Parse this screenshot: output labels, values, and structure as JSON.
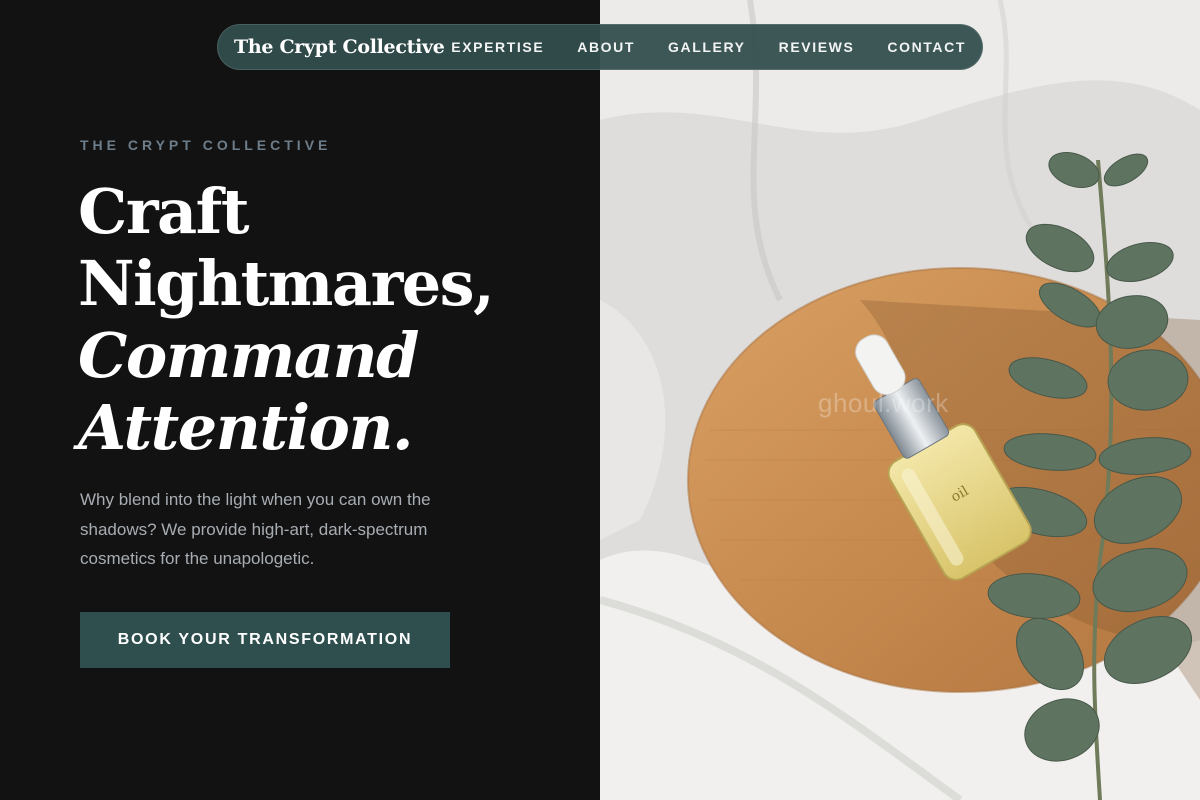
{
  "nav": {
    "brand": "The Crypt Collective",
    "links": [
      "EXPERTISE",
      "ABOUT",
      "GALLERY",
      "REVIEWS",
      "CONTACT"
    ]
  },
  "hero": {
    "eyebrow": "THE CRYPT COLLECTIVE",
    "headline_lines": [
      "Craft",
      "Nightmares,",
      "Command",
      "Attention."
    ],
    "description": "Why blend into the light when you can own the shadows? We provide high-art, dark-spectrum cosmetics for the unapologetic.",
    "cta_label": "BOOK YOUR TRANSFORMATION"
  },
  "image": {
    "watermark": "ghoul.work",
    "bottle_label": "oil"
  },
  "colors": {
    "background": "#121212",
    "accent": "#2f4f4f",
    "nav": "#314e4d",
    "eyebrow": "#6d7d8a",
    "body_text": "#a7adb3"
  }
}
